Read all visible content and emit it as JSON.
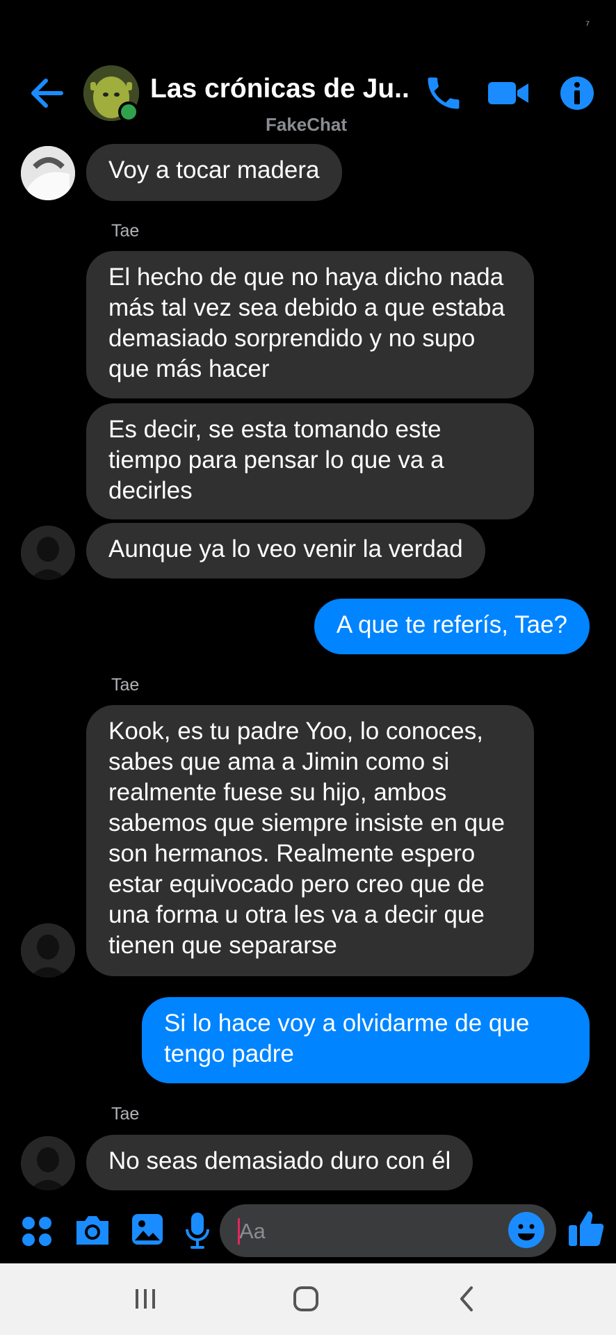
{
  "status": {
    "indicator": "⁷"
  },
  "header": {
    "title": "Las crónicas de Ju...",
    "subtitle": "FakeChat"
  },
  "messages": [
    {
      "text": "Voy a tocar madera"
    },
    {
      "sender": "Tae",
      "text": "El hecho de que no haya dicho nada más tal vez sea debido a que estaba demasiado sorprendido y no supo que más hacer"
    },
    {
      "text": "Es decir, se esta tomando este tiempo para pensar lo que va a decirles"
    },
    {
      "text": "Aunque ya lo veo venir la verdad"
    },
    {
      "text": "A que te referís, Tae?"
    },
    {
      "sender": "Tae",
      "text": "Kook, es tu padre Yoo, lo conoces, sabes que ama a Jimin como si realmente fuese su hijo, ambos sabemos que siempre insiste en que son hermanos. Realmente espero estar equivocado pero creo que de una forma u otra les va a decir que tienen que separarse"
    },
    {
      "text": "Si lo hace voy a olvidarme de que tengo padre"
    },
    {
      "sender": "Tae",
      "text": "No seas demasiado duro con él"
    }
  ],
  "composer": {
    "placeholder": "Aa"
  },
  "colors": {
    "accent": "#0084ff",
    "incoming": "#303030",
    "background": "#000000",
    "online": "#31a24c"
  }
}
